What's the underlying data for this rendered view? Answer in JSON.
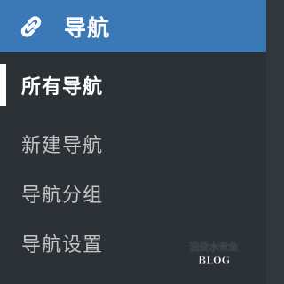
{
  "menu": {
    "title": "导航",
    "icon": "link-icon",
    "header_color": "#3a78b8",
    "items": [
      {
        "label": "所有导航",
        "current": true
      },
      {
        "label": "新建导航",
        "current": false
      },
      {
        "label": "导航分组",
        "current": false
      },
      {
        "label": "导航设置",
        "current": false
      }
    ]
  },
  "watermark": {
    "line1": "我爱水煮鱼",
    "line2": "BLOG"
  }
}
